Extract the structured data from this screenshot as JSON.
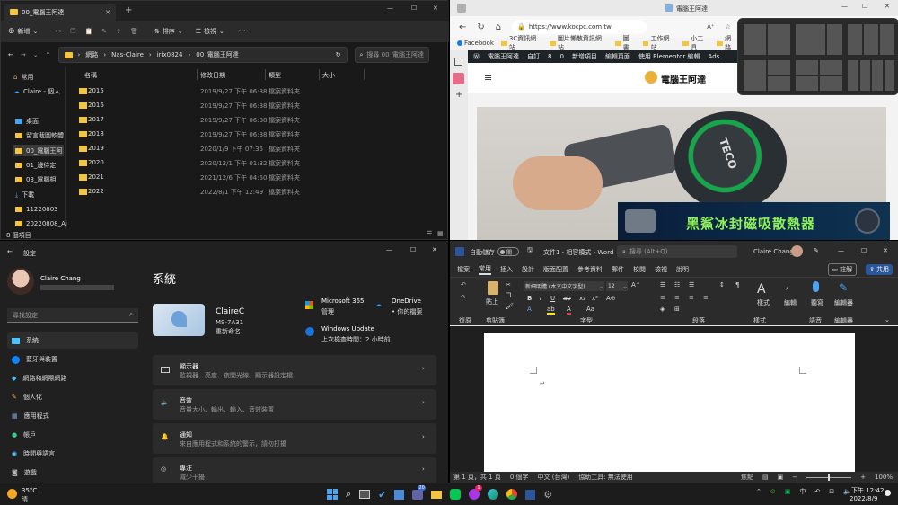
{
  "explorer": {
    "tab_title": "00_電腦王阿達",
    "new_label": "新增",
    "sort_label": "排序",
    "view_label": "檢視",
    "more_label": "···",
    "path": [
      "網路",
      "Nas-Claire",
      "irix0824",
      "00_電腦王阿達"
    ],
    "search_placeholder": "搜尋 00_電腦王阿達",
    "nav": [
      "常用",
      "Claire - 個人",
      "桌面",
      "留言截圖軟體",
      "00_電腦王阿",
      "01_邊待定",
      "03_電腦相",
      "下載",
      "11220803",
      "20220808_Ai"
    ],
    "columns": [
      "名稱",
      "修改日期",
      "類型",
      "大小"
    ],
    "rows": [
      {
        "name": "2015",
        "date": "2019/9/27 下午 06:38",
        "type": "檔案資料夾"
      },
      {
        "name": "2016",
        "date": "2019/9/27 下午 06:38",
        "type": "檔案資料夾"
      },
      {
        "name": "2017",
        "date": "2019/9/27 下午 06:38",
        "type": "檔案資料夾"
      },
      {
        "name": "2018",
        "date": "2019/9/27 下午 06:38",
        "type": "檔案資料夾"
      },
      {
        "name": "2019",
        "date": "2020/1/9 下午 07:35",
        "type": "檔案資料夾"
      },
      {
        "name": "2020",
        "date": "2020/12/1 下午 01:32",
        "type": "檔案資料夾"
      },
      {
        "name": "2021",
        "date": "2021/12/6 下午 04:50",
        "type": "檔案資料夾"
      },
      {
        "name": "2022",
        "date": "2022/8/1 下午 12:49",
        "type": "檔案資料夾"
      }
    ],
    "status": "8 個項目"
  },
  "browser": {
    "tab_title": "電腦王阿達",
    "url": "https://www.kocpc.com.tw",
    "favs": [
      "Facebook",
      "3C資訊網站",
      "圖片懶散資訊網站",
      "圖書",
      "工作網站",
      "小工具",
      "網路"
    ],
    "wp_bar": [
      "電腦王阿達",
      "自訂",
      "8",
      "0",
      "新增項目",
      "編輯頁面",
      "使用 Elementor 編輯",
      "Ads"
    ],
    "site_name": "電腦王阿達",
    "product_text": "TECO",
    "banner_text": "黑鯊冰封磁吸散熱器"
  },
  "settings": {
    "app_title": "設定",
    "user_name": "Claire Chang",
    "search_placeholder": "尋找設定",
    "nav": [
      "系統",
      "藍牙與裝置",
      "網路和網際網路",
      "個人化",
      "應用程式",
      "帳戶",
      "時間與語言",
      "遊戲"
    ],
    "page_title": "系統",
    "device_name": "ClaireC",
    "device_model": "MS-7A31",
    "rename": "重新命名",
    "m365_title": "Microsoft 365",
    "m365_sub": "管理",
    "onedrive_title": "OneDrive",
    "onedrive_sub": "• 你的檔案",
    "wu_title": "Windows Update",
    "wu_sub": "上次檢查時間：2 小時前",
    "cards": [
      {
        "title": "顯示器",
        "sub": "監視器、亮度、夜間光線、顯示器設定檔"
      },
      {
        "title": "音效",
        "sub": "音量大小、輸出、輸入、音效裝置"
      },
      {
        "title": "通知",
        "sub": "來自應用程式和系統的警示，請勿打擾"
      },
      {
        "title": "專注",
        "sub": "減少干擾"
      }
    ]
  },
  "word": {
    "autosave": "自動儲存",
    "toggle": "關",
    "doc_title": "文件1 - 相容模式 - Word",
    "search": "搜尋 (Alt+Q)",
    "user": "Claire Chang",
    "tabs": [
      "檔案",
      "常用",
      "插入",
      "設計",
      "版面配置",
      "參考資料",
      "郵件",
      "校閱",
      "檢視",
      "說明"
    ],
    "comment_btn": "註解",
    "share_btn": "共用",
    "font_name": "新細明體 (本文中文字型)",
    "font_size": "12",
    "groups": [
      "復原",
      "剪貼簿",
      "字型",
      "段落",
      "樣式",
      "語音",
      "編輯器"
    ],
    "paste_label": "貼上",
    "styles_label": "樣式",
    "edit_label": "編輯",
    "dictate_label": "聽寫",
    "editor_label": "編輯器",
    "status": [
      "第 1 頁，共 1 頁",
      "0 個字",
      "中文 (台灣)",
      "協助工具: 無法使用",
      "焦點"
    ],
    "zoom": "100%"
  },
  "taskbar": {
    "weather_temp": "35°C",
    "weather_desc": "晴",
    "ime": "中",
    "time": "下午 12:42",
    "date": "2022/8/9",
    "badge_count": "20",
    "notif_count": "1"
  },
  "colors": {
    "folder": "#f5c542",
    "accent": "#2b579a",
    "settings_accent": "#4cc2ff"
  }
}
